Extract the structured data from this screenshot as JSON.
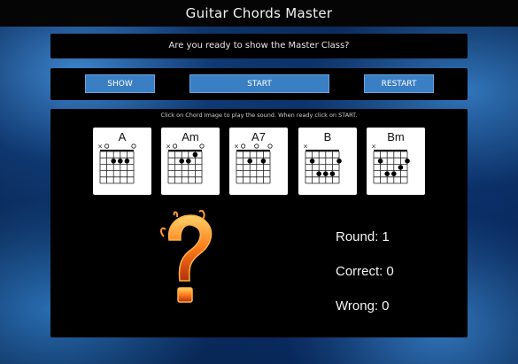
{
  "app": {
    "title": "Guitar Chords Master"
  },
  "prompt": {
    "text": "Are you ready to show the Master Class?"
  },
  "controls": {
    "show_label": "SHOW",
    "start_label": "START",
    "restart_label": "RESTART"
  },
  "main": {
    "instructions": "Click on Chord Image to play the sound. When ready click on START.",
    "chords": [
      {
        "name": "A",
        "markers": "xo   o",
        "dots": [
          [
            2,
            2
          ],
          [
            3,
            2
          ],
          [
            4,
            2
          ]
        ]
      },
      {
        "name": "Am",
        "markers": "xo   o",
        "dots": [
          [
            2,
            2
          ],
          [
            3,
            2
          ],
          [
            4,
            1
          ]
        ]
      },
      {
        "name": "A7",
        "markers": "xo o o",
        "dots": [
          [
            2,
            2
          ],
          [
            4,
            2
          ]
        ]
      },
      {
        "name": "B",
        "markers": "x     ",
        "dots": [
          [
            1,
            2
          ],
          [
            2,
            4
          ],
          [
            3,
            4
          ],
          [
            4,
            4
          ],
          [
            5,
            2
          ]
        ]
      },
      {
        "name": "Bm",
        "markers": "x     ",
        "dots": [
          [
            1,
            2
          ],
          [
            2,
            4
          ],
          [
            3,
            4
          ],
          [
            4,
            3
          ],
          [
            5,
            2
          ]
        ]
      }
    ],
    "stats": {
      "round_label": "Round:",
      "round_value": "1",
      "correct_label": "Correct:",
      "correct_value": "0",
      "wrong_label": "Wrong:",
      "wrong_value": "0"
    },
    "question_icon": "flaming-question-mark-icon"
  },
  "colors": {
    "accent": "#3a7fc4",
    "panel": "#000000",
    "flame": "#ff7a1a"
  }
}
